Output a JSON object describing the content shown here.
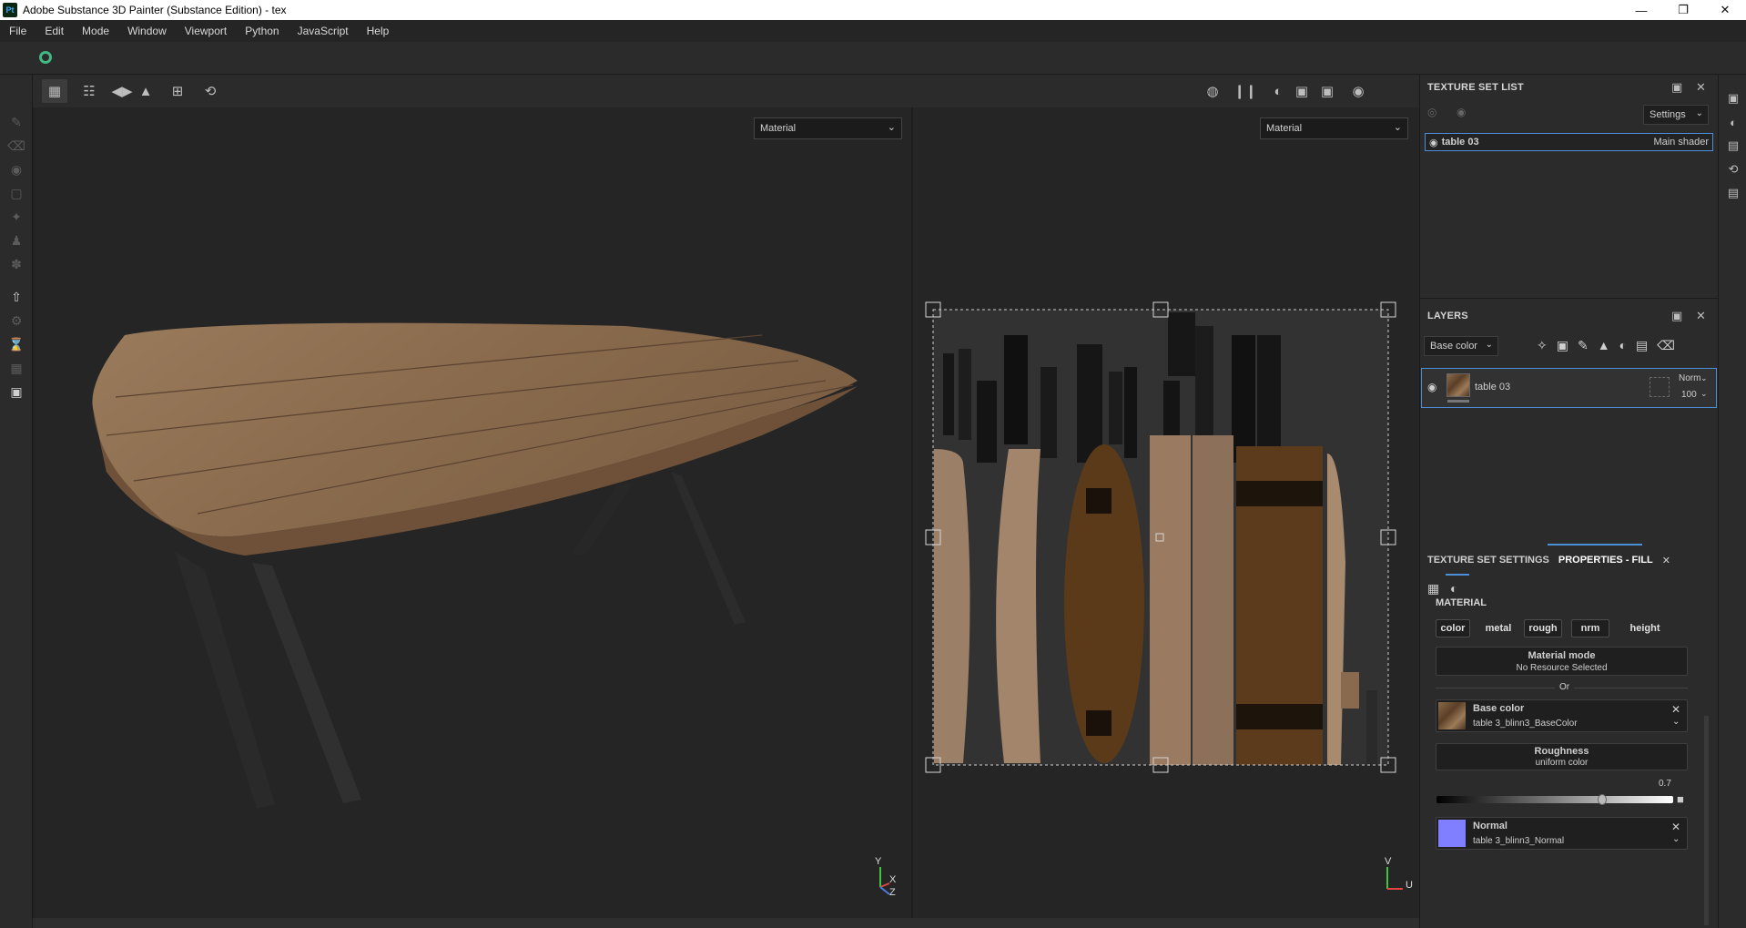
{
  "window": {
    "app_icon": "Pt",
    "title": "Adobe Substance 3D Painter (Substance Edition) - tex",
    "controls": [
      "minimize-icon",
      "restore-icon",
      "close-icon"
    ]
  },
  "menu": [
    "File",
    "Edit",
    "Mode",
    "Window",
    "Viewport",
    "Python",
    "JavaScript",
    "Help"
  ],
  "viewport": {
    "left_select": "Material",
    "right_select": "Material",
    "axis_3d": {
      "y": "Y",
      "x": "X",
      "z": "Z"
    },
    "axis_2d": {
      "v": "V",
      "u": "U"
    }
  },
  "texture_set_list": {
    "header": "TEXTURE SET LIST",
    "settings_label": "Settings",
    "row_name": "table 03",
    "row_shader": "Main shader"
  },
  "layers": {
    "header": "LAYERS",
    "channel_select": "Base color",
    "layer_name": "table 03",
    "blend_mode": "Norm",
    "opacity": "100"
  },
  "properties": {
    "tab_settings": "TEXTURE SET SETTINGS",
    "tab_fill": "PROPERTIES - FILL",
    "section": "MATERIAL",
    "channels": [
      "color",
      "metal",
      "rough",
      "nrm",
      "height"
    ],
    "material_mode_title": "Material mode",
    "material_mode_value": "No Resource Selected",
    "or_label": "Or",
    "base_color_title": "Base color",
    "base_color_value": "table 3_blinn3_BaseColor",
    "roughness_title": "Roughness",
    "roughness_value": "uniform color",
    "roughness_number": "0.7",
    "roughness_level": 0.7,
    "normal_title": "Normal",
    "normal_value": "table 3_blinn3_Normal",
    "normal_swatch": "#7f7fff"
  },
  "colors": {
    "accent": "#4a8fd8",
    "panel": "#2b2b2b",
    "viewport": "#252525"
  }
}
